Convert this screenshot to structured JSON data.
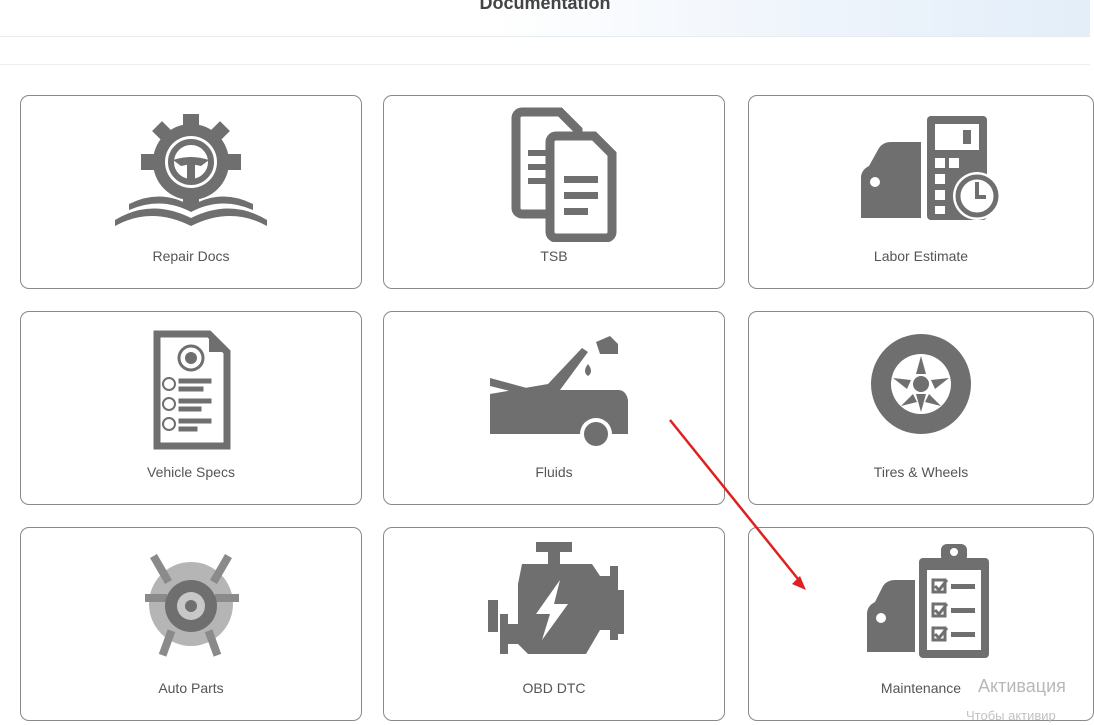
{
  "header": {
    "title": "Documentation"
  },
  "tiles": [
    {
      "label": "Repair Docs",
      "icon": "gear-steering-book-icon"
    },
    {
      "label": "TSB",
      "icon": "documents-icon"
    },
    {
      "label": "Labor Estimate",
      "icon": "car-calculator-clock-icon"
    },
    {
      "label": "Vehicle Specs",
      "icon": "spec-sheet-icon"
    },
    {
      "label": "Fluids",
      "icon": "car-hood-oil-icon"
    },
    {
      "label": "Tires & Wheels",
      "icon": "tire-wheel-icon"
    },
    {
      "label": "Auto Parts",
      "icon": "auto-parts-icon"
    },
    {
      "label": "OBD DTC",
      "icon": "engine-bolt-icon"
    },
    {
      "label": "Maintenance",
      "icon": "car-checklist-icon"
    }
  ],
  "watermark": {
    "line1": "Активация",
    "line2": "Чтобы активир"
  },
  "colors": {
    "icon": "#6f6f6f",
    "arrow": "#e02020",
    "border": "#8a8a8a"
  }
}
